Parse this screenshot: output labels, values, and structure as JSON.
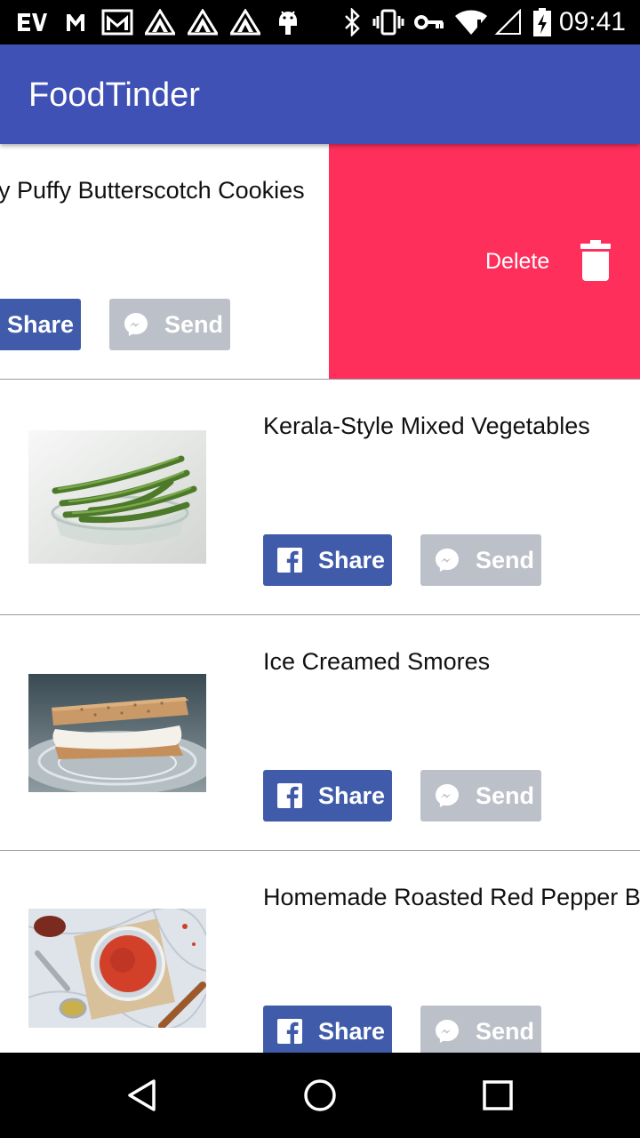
{
  "status_bar": {
    "time": "09:41",
    "icons": [
      "ev-icon",
      "gmail-icon",
      "mail-icon",
      "triangle-app-icon",
      "triangle-app-icon",
      "triangle-app-icon",
      "android-icon",
      "bluetooth-icon",
      "vibrate-icon",
      "key-icon",
      "wifi-icon",
      "signal-icon",
      "battery-charging-icon"
    ]
  },
  "app_bar": {
    "title": "FoodTinder"
  },
  "colors": {
    "primary": "#3F51B5",
    "delete": "#FF2F5C",
    "share": "#3F5BAA",
    "send_disabled": "#BCC0C8"
  },
  "swiped_item": {
    "title": "Fluffy Puffy Butterscotch Cookies",
    "share_label": "Share",
    "send_label": "Send",
    "delete_label": "Delete"
  },
  "items": [
    {
      "title": "Kerala-Style Mixed Vegetables",
      "share_label": "Share",
      "send_label": "Send",
      "image": "green-beans-photo"
    },
    {
      "title": "Ice Creamed Smores",
      "share_label": "Share",
      "send_label": "Send",
      "image": "smores-photo"
    },
    {
      "title": "Homemade Roasted Red Pepper Bisque",
      "share_label": "Share",
      "send_label": "Send",
      "image": "red-pepper-spread-photo"
    }
  ],
  "nav_bar": {
    "buttons": [
      "back-icon",
      "home-icon",
      "recents-icon"
    ]
  }
}
